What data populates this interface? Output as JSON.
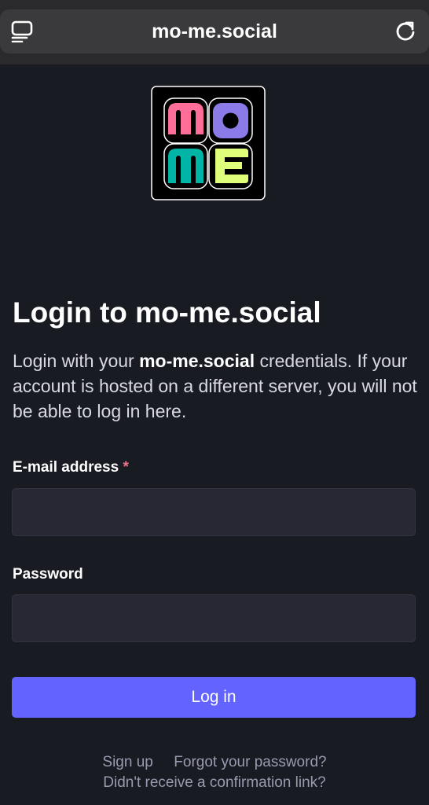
{
  "browser": {
    "url": "mo-me.social",
    "tabs_icon": "tabs-list-icon",
    "reload_icon": "reload-icon"
  },
  "logo": {
    "text": "mo me",
    "colors": [
      "#ff6e99",
      "#8a7be8",
      "#00b4a6",
      "#dfff7a"
    ]
  },
  "login": {
    "title": "Login to mo-me.social",
    "intro_prefix": "Login with your ",
    "intro_server": "mo-me.social",
    "intro_suffix": " credentials. If your account is hosted on a different server, you will not be able to log in here.",
    "email_label": "E-mail address",
    "required_mark": "*",
    "email_value": "",
    "password_label": "Password",
    "password_value": "",
    "button_label": "Log in"
  },
  "links": {
    "sign_up": "Sign up",
    "forgot_password": "Forgot your password?",
    "confirmation": "Didn't receive a confirmation link?"
  },
  "colors": {
    "background": "#191b22",
    "accent": "#6364ff",
    "field_bg": "#282834",
    "required": "#f0718a"
  }
}
